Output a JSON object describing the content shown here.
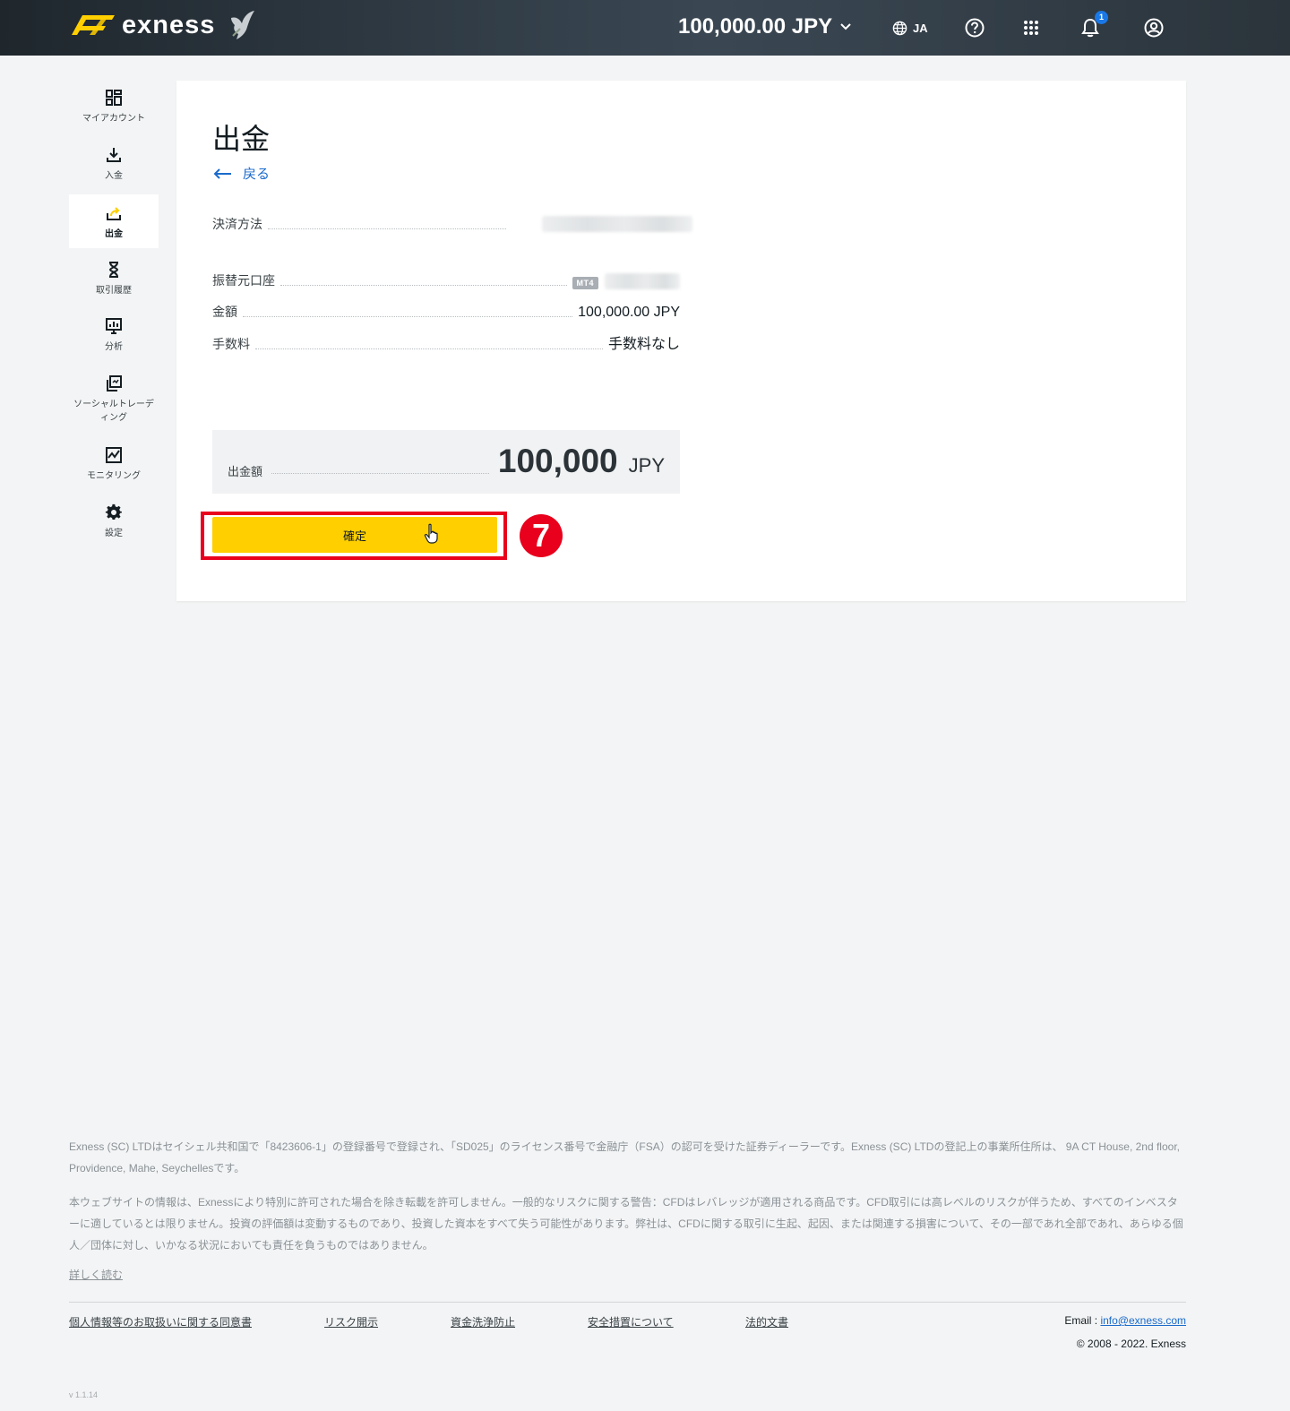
{
  "header": {
    "brand": "exness",
    "balance": "100,000.00 JPY",
    "language": "JA",
    "notification_count": "1"
  },
  "sidebar": {
    "items": [
      {
        "label": "マイアカウント",
        "icon": "dashboard-icon"
      },
      {
        "label": "入金",
        "icon": "download-icon"
      },
      {
        "label": "出金",
        "icon": "upload-icon",
        "active": true
      },
      {
        "label": "取引履歴",
        "icon": "hourglass-icon"
      },
      {
        "label": "分析",
        "icon": "analytics-icon"
      },
      {
        "label": "ソーシャルトレーディング",
        "icon": "copy-icon"
      },
      {
        "label": "モニタリング",
        "icon": "monitor-icon"
      },
      {
        "label": "設定",
        "icon": "gear-icon"
      }
    ]
  },
  "main": {
    "title": "出金",
    "back_label": "戻る",
    "rows": {
      "payment_method": {
        "label": "決済方法"
      },
      "source_account": {
        "label": "振替元口座",
        "badge": "MT4"
      },
      "amount": {
        "label": "金額",
        "value": "100,000.00 JPY"
      },
      "fee": {
        "label": "手数料",
        "value": "手数料なし"
      }
    },
    "total": {
      "label": "出金額",
      "amount": "100,000",
      "currency": "JPY"
    },
    "confirm_label": "確定",
    "step_number": "7"
  },
  "footer": {
    "para1": "Exness (SC) LTDはセイシェル共和国で「8423606-1」の登録番号で登録され、「SD025」のライセンス番号で金融庁（FSA）の認可を受けた証券ディーラーです。Exness (SC) LTDの登記上の事業所住所は、 9A CT House, 2nd floor, Providence, Mahe, Seychellesです。",
    "para2": "本ウェブサイトの情報は、Exnessにより特別に許可された場合を除き転載を許可しません。一般的なリスクに関する警告：CFDはレバレッジが適用される商品です。CFD取引には高レベルのリスクが伴うため、すべてのインベスターに適しているとは限りません。投資の評価額は変動するものであり、投資した資本をすべて失う可能性があります。弊社は、CFDに関する取引に生起、起因、または関連する損害について、その一部であれ全部であれ、あらゆる個人／団体に対し、いかなる状況においても責任を負うものではありません。",
    "read_more": "詳しく読む",
    "links": [
      "個人情報等のお取扱いに関する同意書",
      "リスク開示",
      "資金洗浄防止",
      "安全措置について",
      "法的文書"
    ],
    "email_label": "Email : ",
    "email": "info@exness.com",
    "copyright": "© 2008 - 2022. Exness",
    "version": "v 1.1.14"
  },
  "colors": {
    "accent_yellow": "#ffcf00",
    "annotation_red": "#e8001c",
    "link_blue": "#1a6bcc"
  }
}
